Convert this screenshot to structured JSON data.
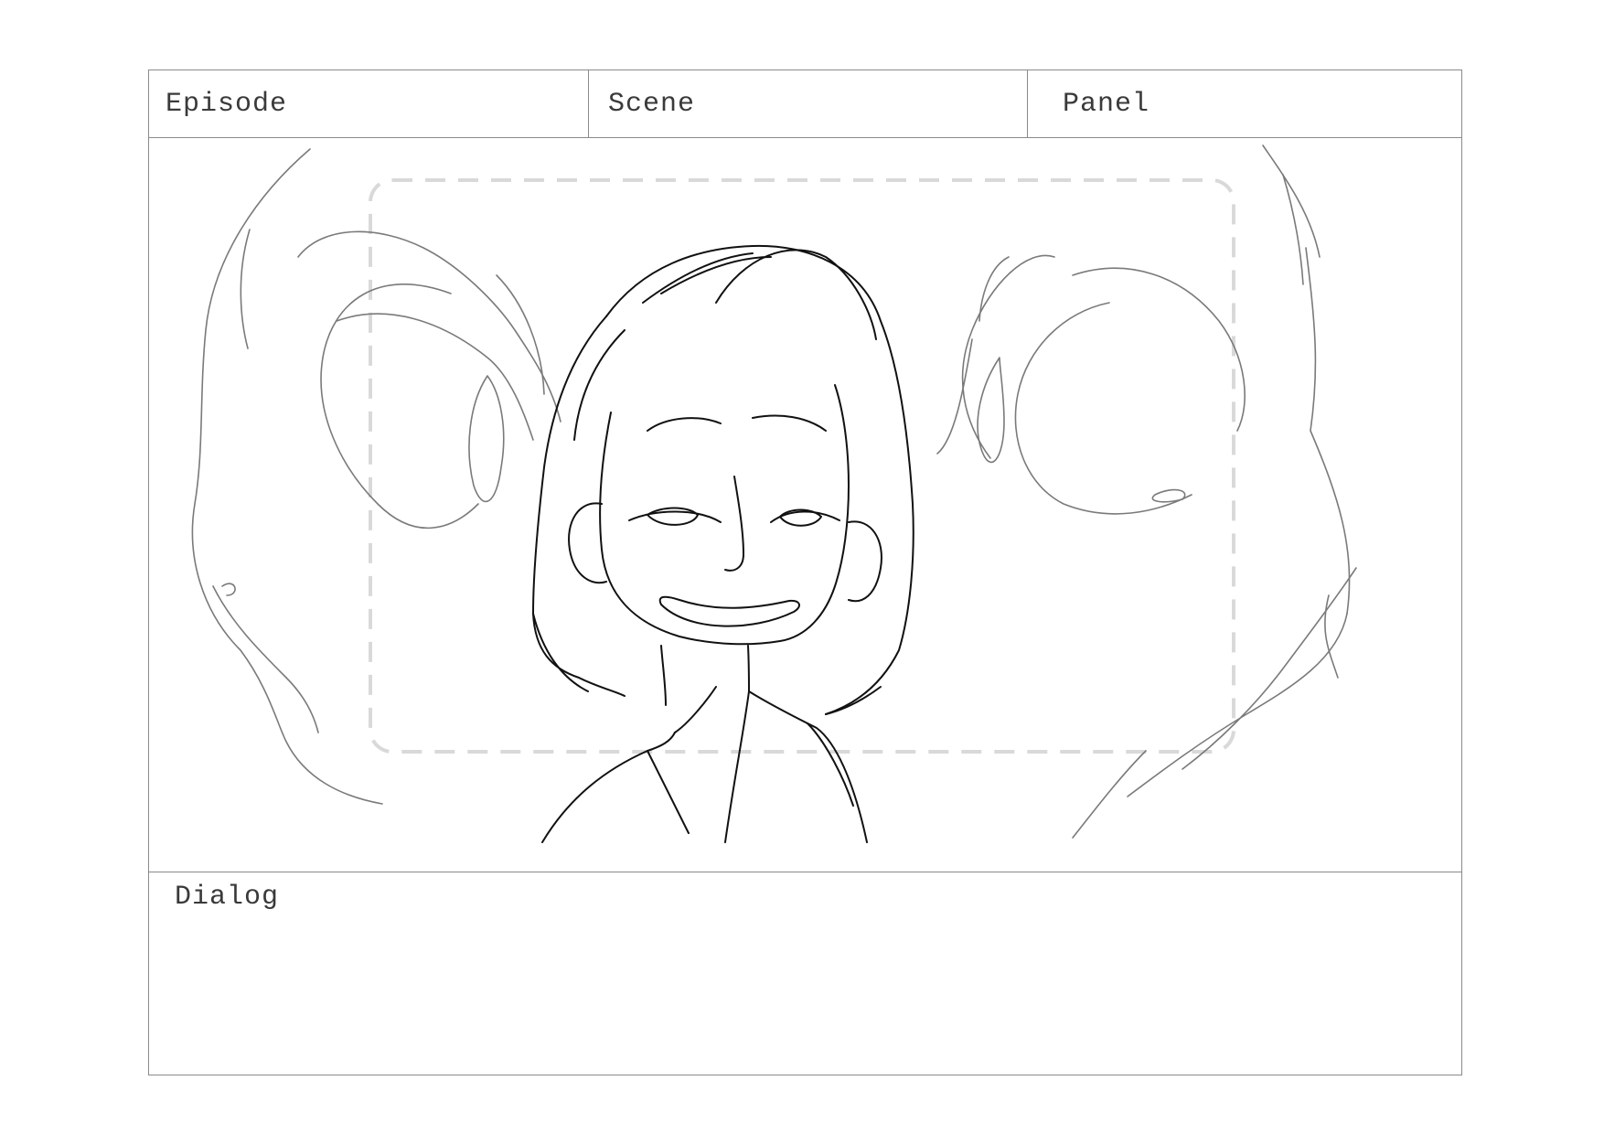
{
  "header": {
    "episode_label": "Episode",
    "scene_label": "Scene",
    "panel_label": "Panel"
  },
  "dialog": {
    "label": "Dialog",
    "text": ""
  },
  "frame": {
    "safe_area_color": "#d9d9d9",
    "foreground_sketch_color": "#111111",
    "background_sketch_color": "#7a7a7a"
  }
}
